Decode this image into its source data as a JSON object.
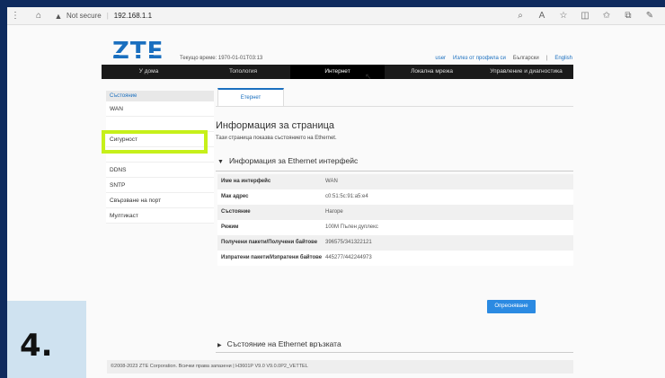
{
  "browser": {
    "security_label": "Not secure",
    "url": "192.168.1.1"
  },
  "header": {
    "logo": "ZTE",
    "time_label": "Текущо време: 1970-01-01T03:13",
    "user": "user",
    "logout": "Излез от профила си",
    "lang_bg": "Български",
    "lang_sep": "|",
    "lang_en": "English"
  },
  "mainnav": [
    {
      "label": "У дома"
    },
    {
      "label": "Топология"
    },
    {
      "label": "Интернет"
    },
    {
      "label": "Локална мрежа"
    },
    {
      "label": "Управление и диагностика"
    }
  ],
  "sidebar": {
    "head": "Състояние",
    "items": [
      {
        "label": "WAN"
      },
      {
        "label": "Сигурност"
      },
      {
        "label": "DDNS"
      },
      {
        "label": "SNTP"
      },
      {
        "label": "Свързване на порт"
      },
      {
        "label": "Мултикаст"
      }
    ]
  },
  "content": {
    "tab": "Етернет",
    "title": "Информация за страница",
    "desc": "Тази страница показва състоянието на Ethernet.",
    "section": "Информация за Ethernet интерфейс",
    "rows": [
      {
        "label": "Име на интерфейс",
        "value": "WAN"
      },
      {
        "label": "Мак адрес",
        "value": "c0:51:5c:91:a5:e4"
      },
      {
        "label": "Състояние",
        "value": "Нагоре"
      },
      {
        "label": "Режим",
        "value": "100M Пълен дуплекс"
      },
      {
        "label": "Получени пакети/Получени байтове",
        "value": "396575/341322121"
      },
      {
        "label": "Изпратени пакети/Изпратени байтове",
        "value": "445277/442244973"
      }
    ],
    "refresh": "Опресняване",
    "connection_section": "Състояние на Ethernet връзката"
  },
  "footer": {
    "text": "©2008-2023 ZTE Corporation. Всички права запазени  |  H3601P V9.0 V9.0.0P2_VETTEL"
  },
  "overlay": {
    "step": "4."
  }
}
